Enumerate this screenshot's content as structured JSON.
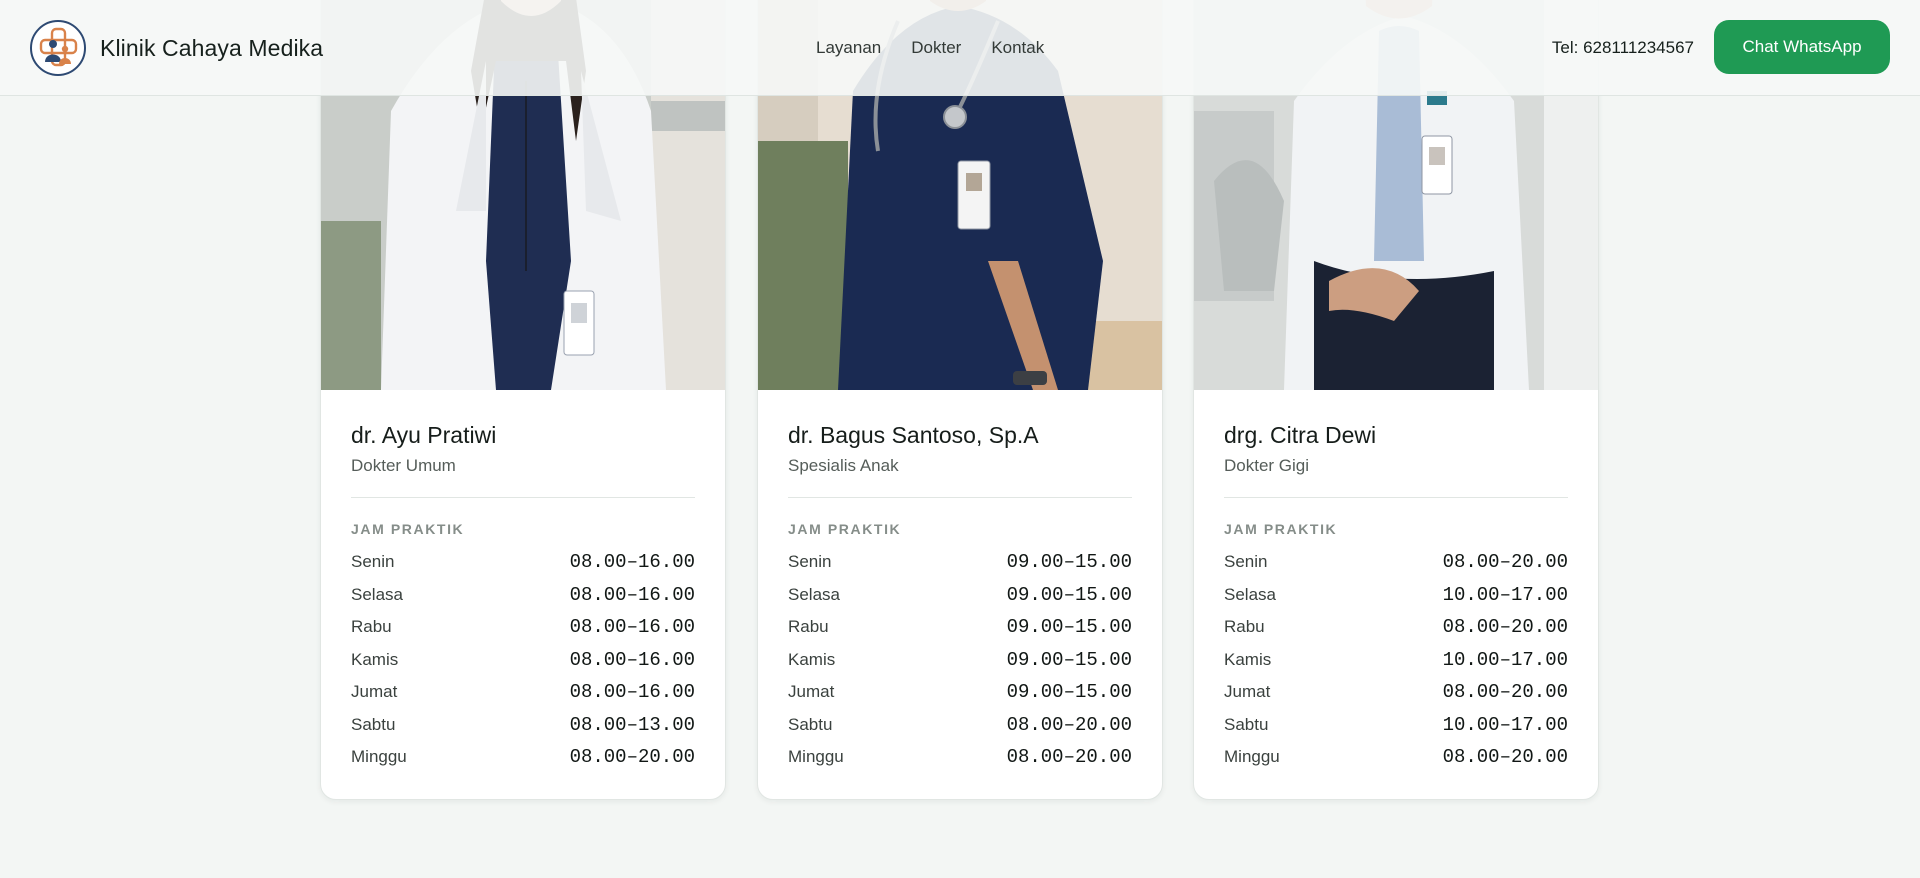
{
  "header": {
    "brand": "Klinik Cahaya Medika",
    "nav": [
      "Layanan",
      "Dokter",
      "Kontak"
    ],
    "phone": "Tel: 628111234567",
    "cta": "Chat WhatsApp"
  },
  "doctors": [
    {
      "name": "dr. Ayu Pratiwi",
      "specialty": "Dokter Umum",
      "schedule_title": "JAM PRAKTIK",
      "schedule": [
        {
          "day": "Senin",
          "time": "08.00–16.00"
        },
        {
          "day": "Selasa",
          "time": "08.00–16.00"
        },
        {
          "day": "Rabu",
          "time": "08.00–16.00"
        },
        {
          "day": "Kamis",
          "time": "08.00–16.00"
        },
        {
          "day": "Jumat",
          "time": "08.00–16.00"
        },
        {
          "day": "Sabtu",
          "time": "08.00–13.00"
        },
        {
          "day": "Minggu",
          "time": "08.00–20.00"
        }
      ]
    },
    {
      "name": "dr. Bagus Santoso, Sp.A",
      "specialty": "Spesialis Anak",
      "schedule_title": "JAM PRAKTIK",
      "schedule": [
        {
          "day": "Senin",
          "time": "09.00–15.00"
        },
        {
          "day": "Selasa",
          "time": "09.00–15.00"
        },
        {
          "day": "Rabu",
          "time": "09.00–15.00"
        },
        {
          "day": "Kamis",
          "time": "09.00–15.00"
        },
        {
          "day": "Jumat",
          "time": "09.00–15.00"
        },
        {
          "day": "Sabtu",
          "time": "08.00–20.00"
        },
        {
          "day": "Minggu",
          "time": "08.00–20.00"
        }
      ]
    },
    {
      "name": "drg. Citra Dewi",
      "specialty": "Dokter Gigi",
      "schedule_title": "JAM PRAKTIK",
      "schedule": [
        {
          "day": "Senin",
          "time": "08.00–20.00"
        },
        {
          "day": "Selasa",
          "time": "10.00–17.00"
        },
        {
          "day": "Rabu",
          "time": "08.00–20.00"
        },
        {
          "day": "Kamis",
          "time": "10.00–17.00"
        },
        {
          "day": "Jumat",
          "time": "08.00–20.00"
        },
        {
          "day": "Sabtu",
          "time": "10.00–17.00"
        },
        {
          "day": "Minggu",
          "time": "08.00–20.00"
        }
      ]
    }
  ],
  "colors": {
    "accent": "#1f9a54",
    "background": "#f3f6f4",
    "brand_navy": "#2e4a73",
    "brand_orange": "#d9824a"
  },
  "icons": [
    "clinic-logo-icon"
  ]
}
